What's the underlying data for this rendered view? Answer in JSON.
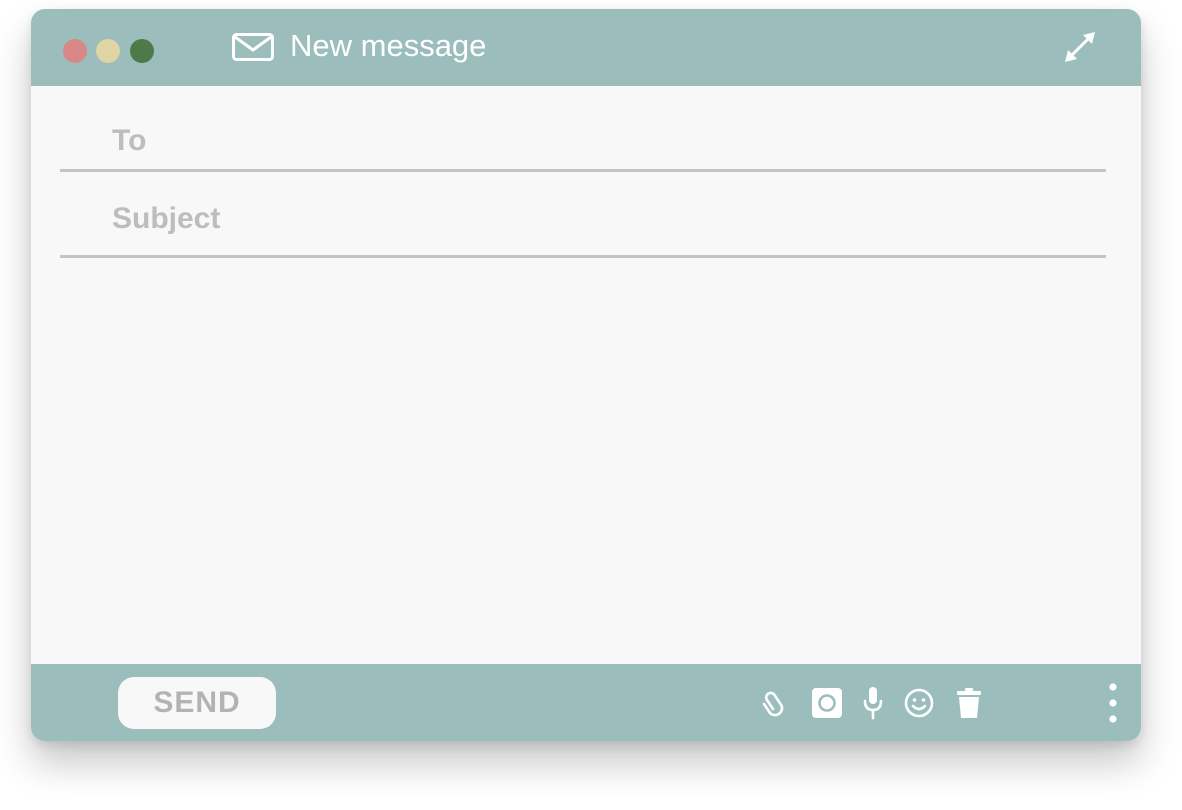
{
  "window": {
    "title": "New message",
    "traffic_lights": {
      "close_color": "#d88886",
      "minimize_color": "#dfd4a4",
      "zoom_color": "#4e7a4a"
    },
    "accent_color": "#9bbdbc",
    "title_icon": "mail-icon",
    "resize_icon": "expand-diagonal-icon"
  },
  "compose": {
    "to_placeholder": "To",
    "to_value": "",
    "subject_placeholder": "Subject",
    "subject_value": "",
    "body_value": ""
  },
  "footer": {
    "send_label": "SEND",
    "tools": [
      "paperclip-icon",
      "camera-icon",
      "microphone-icon",
      "emoji-icon",
      "trash-icon"
    ],
    "overflow_icon": "more-vertical-icon"
  }
}
